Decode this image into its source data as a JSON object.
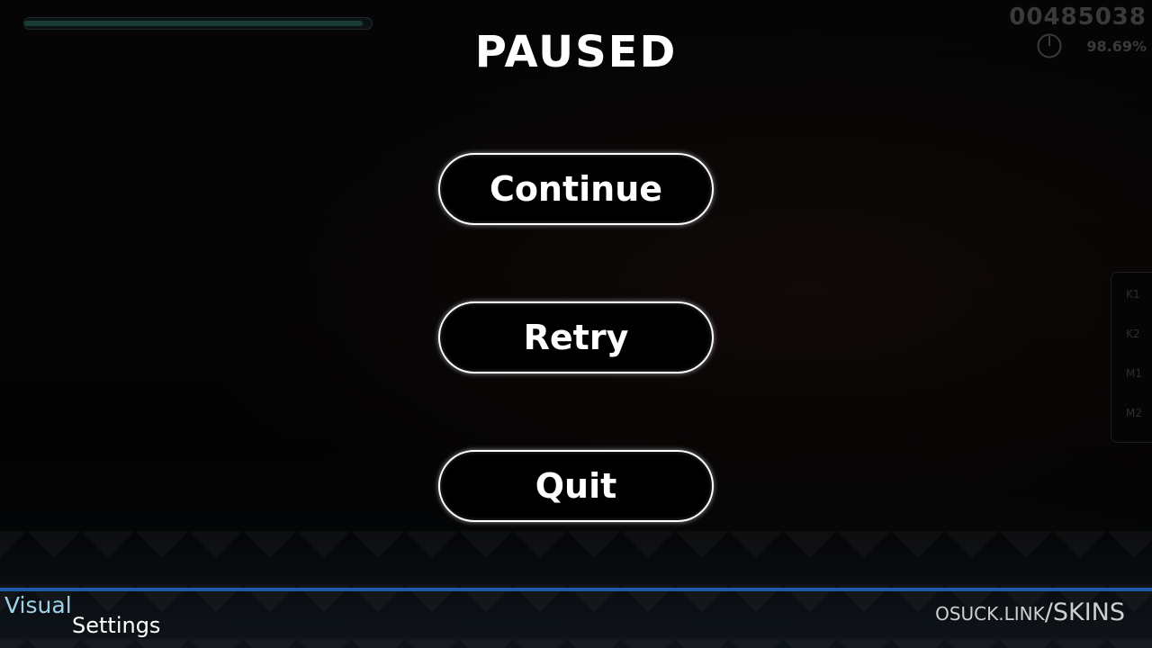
{
  "hud": {
    "score": "00485038",
    "accuracy": "98.69%",
    "progress_fraction": 0.98
  },
  "pause_menu": {
    "title": "PAUSED",
    "continue_label": "Continue",
    "retry_label": "Retry",
    "quit_label": "Quit"
  },
  "key_overlay": {
    "keys": [
      "K1",
      "K2",
      "M1",
      "M2"
    ]
  },
  "bottom_bar": {
    "visual_label": "Visual",
    "settings_label": "Settings",
    "watermark_domain": "OSUCK.LINK",
    "watermark_path": "/SKINS"
  },
  "colors": {
    "accent_blue": "#1f5aa8",
    "visual_cyan": "#9fd2e6"
  },
  "icons": {
    "timer": "timer-pie-icon"
  }
}
